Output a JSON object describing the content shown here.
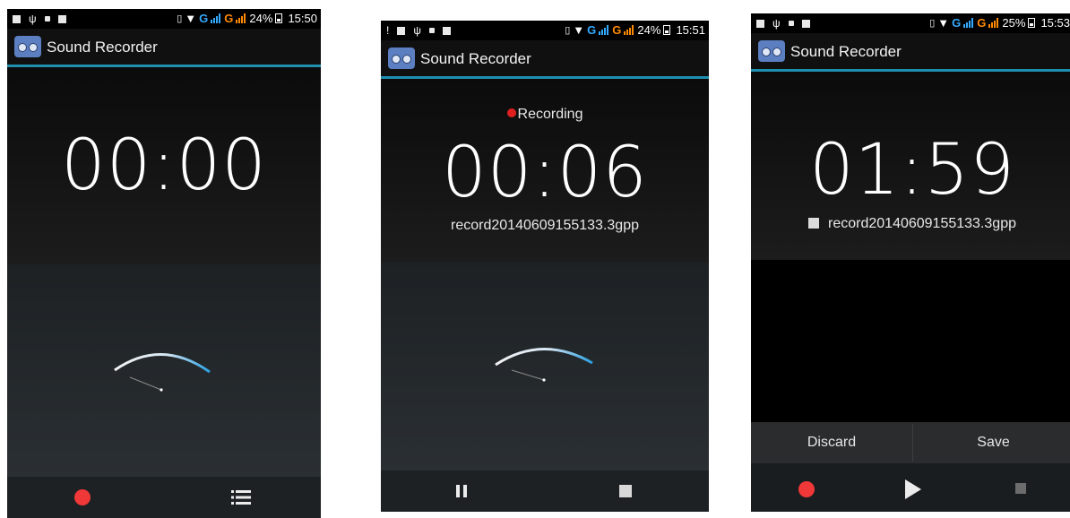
{
  "app": {
    "title": "Sound Recorder"
  },
  "screens": [
    {
      "status": {
        "battery": "24%",
        "time": "15:50"
      },
      "timer": "00:00",
      "controls": {
        "record": "record-button",
        "list": "list-button"
      }
    },
    {
      "status": {
        "battery": "24%",
        "time": "15:51"
      },
      "recording_label": "Recording",
      "timer": "00:06",
      "filename": "record20140609155133.3gpp",
      "controls": {
        "pause": "pause-button",
        "stop": "stop-button"
      }
    },
    {
      "status": {
        "battery": "25%",
        "time": "15:53"
      },
      "timer": "01:59",
      "filename": "record20140609155133.3gpp",
      "actions": {
        "discard": "Discard",
        "save": "Save"
      },
      "controls": {
        "record": "record-button",
        "play": "play-button",
        "stop": "stop-button"
      }
    }
  ],
  "status_icons": {
    "network": "G"
  },
  "colors": {
    "accent": "#1f8fb0",
    "record_red": "#f03838",
    "meter_blue": "#2a9fe0"
  }
}
